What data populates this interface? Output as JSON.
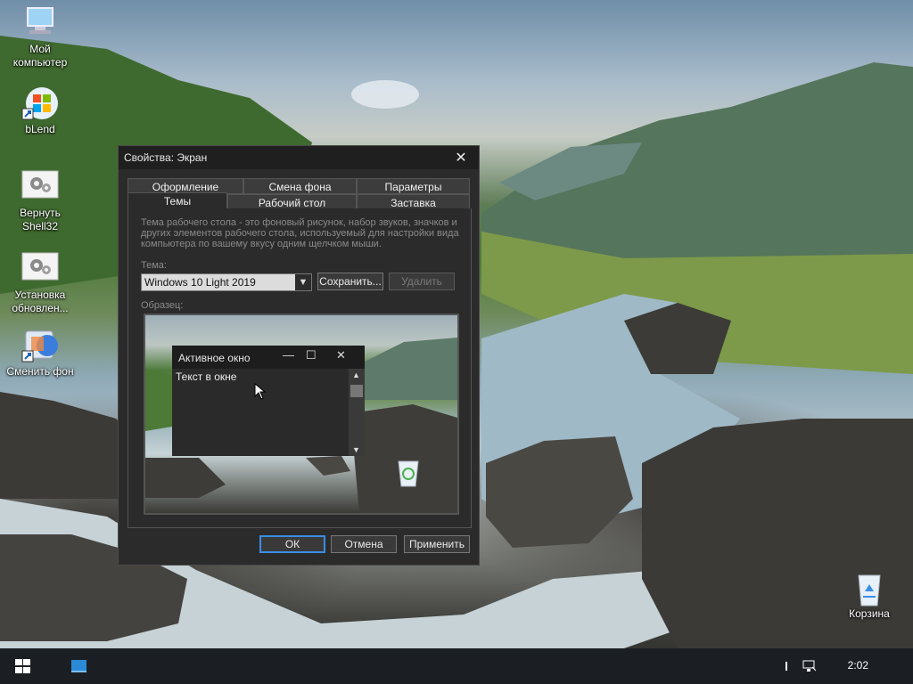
{
  "desktop": {
    "icons": [
      {
        "label_line1": "Мой",
        "label_line2": "компьютер",
        "icon": "computer-icon"
      },
      {
        "label_line1": "bLend",
        "label_line2": "",
        "icon": "windows-logo-shortcut-icon"
      },
      {
        "label_line1": "Вернуть",
        "label_line2": "Shell32",
        "icon": "gears-icon"
      },
      {
        "label_line1": "Установка",
        "label_line2": "обновлен...",
        "icon": "gears-icon"
      },
      {
        "label_line1": "Сменить фон",
        "label_line2": "",
        "icon": "wallpaper-shortcut-icon"
      },
      {
        "label_line1": "Корзина",
        "label_line2": "",
        "icon": "recycle-bin-icon"
      }
    ]
  },
  "dialog": {
    "title": "Свойства: Экран",
    "close_glyph": "✕",
    "tabs_row1": [
      "Оформление",
      "Смена фона",
      "Параметры"
    ],
    "tabs_row2": [
      "Темы",
      "Рабочий стол",
      "Заставка"
    ],
    "active_tab": "Темы",
    "description": "Тема рабочего стола - это фоновый рисунок, набор звуков, значков и других элементов рабочего стола, используемый для настройки вида компьютера по вашему вкусу одним щелчком мыши.",
    "theme_label": "Тема:",
    "theme_value": "Windows 10 Light 2019",
    "save_label": "Сохранить...",
    "delete_label": "Удалить",
    "sample_label": "Образец:",
    "preview": {
      "window_title": "Активное окно",
      "window_text": "Текст в окне"
    },
    "ok_label": "ОК",
    "cancel_label": "Отмена",
    "apply_label": "Применить"
  },
  "taskbar": {
    "clock": "2:02"
  },
  "colors": {
    "dialog_bg": "#2b2b2b",
    "accent": "#3a8ee6",
    "taskbar": "#1b1f24"
  }
}
